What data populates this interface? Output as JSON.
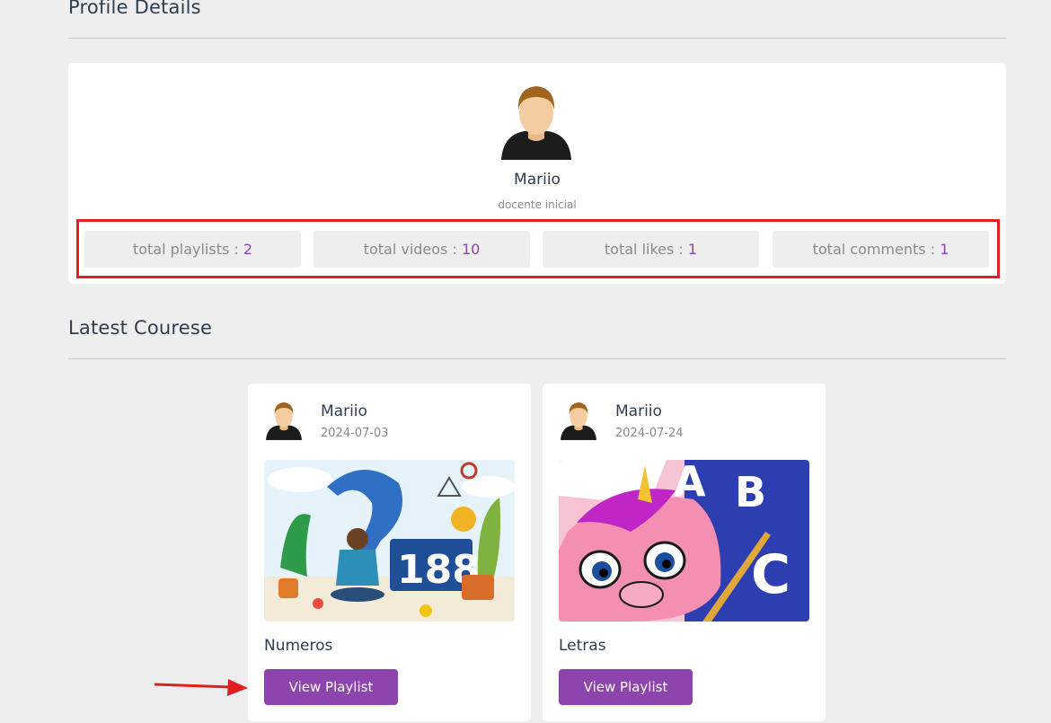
{
  "profile_section": {
    "title": "Profile Details",
    "name": "Mariio",
    "role": "docente inicial",
    "stats": [
      {
        "label": "total playlists : ",
        "value": "2"
      },
      {
        "label": "total videos : ",
        "value": "10"
      },
      {
        "label": "total likes : ",
        "value": "1"
      },
      {
        "label": "total comments : ",
        "value": "1"
      }
    ]
  },
  "courses_section": {
    "title": "Latest Courese",
    "courses": [
      {
        "author": "Mariio",
        "date": "2024-07-03",
        "title": "Numeros",
        "button_label": "View Playlist"
      },
      {
        "author": "Mariio",
        "date": "2024-07-24",
        "title": "Letras",
        "button_label": "View Playlist"
      }
    ]
  },
  "colors": {
    "accent": "#8e44ad",
    "highlight_box": "#e02020",
    "background": "#eeeeee"
  }
}
